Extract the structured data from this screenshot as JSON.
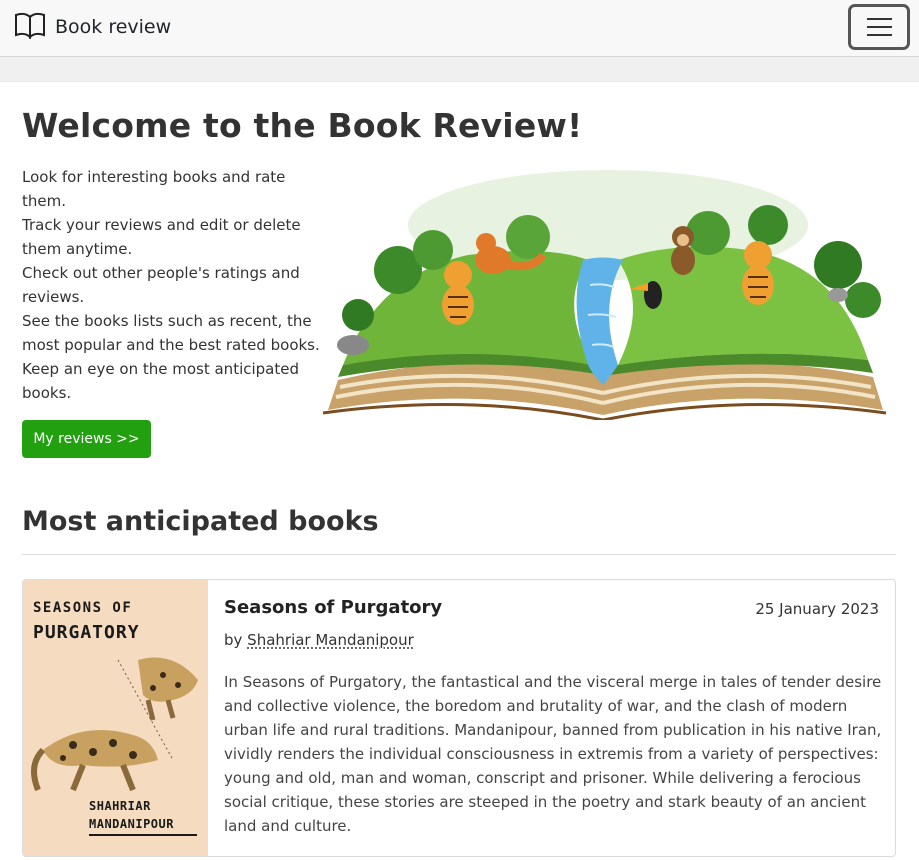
{
  "navbar": {
    "brand": "Book review",
    "brand_icon": "open-book-icon",
    "toggler_icon": "hamburger-menu-icon"
  },
  "hero": {
    "title": "Welcome to the Book Review!",
    "lines": [
      "Look for interesting books and rate them.",
      "Track your reviews and edit or delete them anytime.",
      "Check out other people's ratings and reviews.",
      "See the books lists such as recent, the most popular and the best rated books.",
      "Keep an eye on the most anticipated books."
    ],
    "button_label": "My reviews >>",
    "image": "open-storybook-jungle-animals-illustration"
  },
  "anticipated": {
    "title": "Most anticipated books",
    "books": [
      {
        "title": "Seasons of Purgatory",
        "date": "25 January 2023",
        "by_prefix": "by ",
        "author": "Shahriar Mandanipour",
        "description": "In Seasons of Purgatory, the fantastical and the visceral merge in tales of tender desire and collective violence, the boredom and brutality of war, and the clash of modern urban life and rural traditions. Mandanipour, banned from publication in his native Iran, vividly renders the individual consciousness in extremis from a variety of perspectives: young and old, man and woman, conscript and prisoner. While delivering a ferocious social critique, these stories are steeped in the poetry and stark beauty of an ancient land and culture.",
        "cover": {
          "title_line_1": "SEASONS OF",
          "title_line_2": "PURGATORY",
          "author_line_1": "SHAHRIAR",
          "author_line_2": "MANDANIPOUR",
          "background": "#f5dcc0"
        }
      }
    ]
  },
  "colors": {
    "primary_button": "#22a00f",
    "navbar_bg": "#f8f8f8"
  }
}
